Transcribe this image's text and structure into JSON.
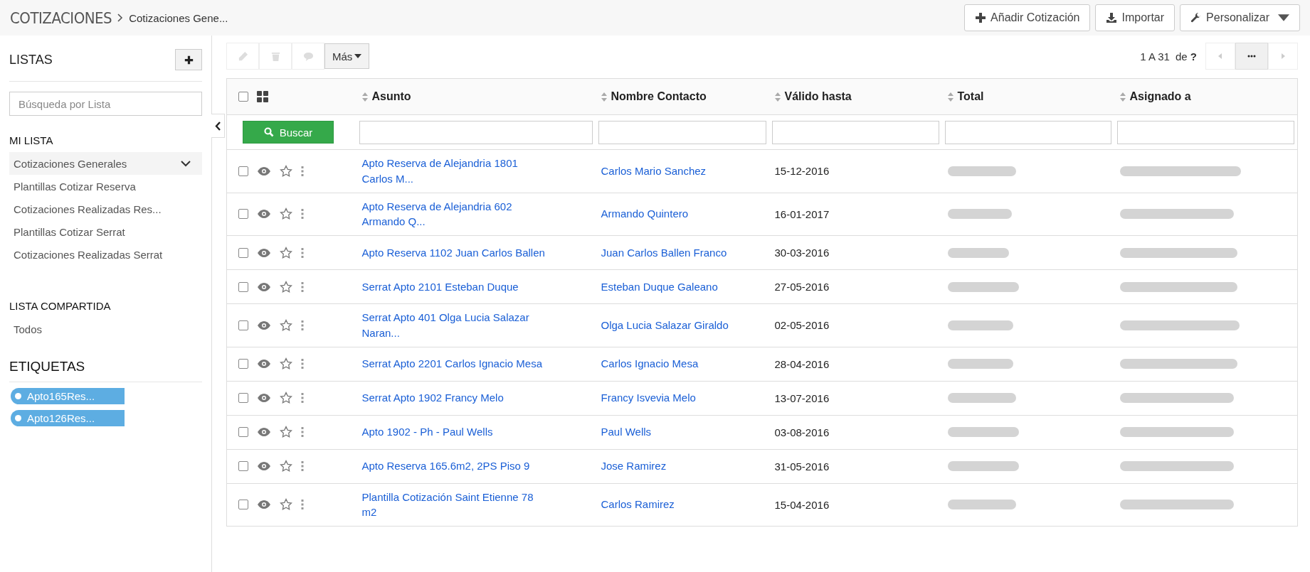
{
  "header": {
    "module": "COTIZACIONES",
    "breadcrumb": "Cotizaciones Gene...",
    "actions": [
      {
        "kind": "add",
        "label": "Añadir Cotización"
      },
      {
        "kind": "import",
        "label": "Importar"
      },
      {
        "kind": "customize",
        "label": "Personalizar"
      }
    ]
  },
  "sidebar": {
    "title": "LISTAS",
    "search": {
      "placeholder": "Búsqueda por Lista"
    },
    "my_lists": {
      "title": "MI LISTA",
      "items": [
        {
          "label": "Cotizaciones Generales",
          "selected": true
        },
        {
          "label": "Plantillas Cotizar Reserva",
          "selected": false
        },
        {
          "label": "Cotizaciones Realizadas Res...",
          "selected": false
        },
        {
          "label": "Plantillas Cotizar Serrat",
          "selected": false
        },
        {
          "label": "Cotizaciones Realizadas Serrat",
          "selected": false
        }
      ]
    },
    "shared_lists": {
      "title": "LISTA COMPARTIDA",
      "items": [
        {
          "label": "Todos",
          "selected": false
        }
      ]
    },
    "tags": {
      "title": "ETIQUETAS",
      "items": [
        {
          "label": "Apto165Res...",
          "color": "#5dade2"
        },
        {
          "label": "Apto126Res...",
          "color": "#5dade2"
        }
      ]
    }
  },
  "toolbar": {
    "more": "Más",
    "pagination": {
      "range": "1 A 31",
      "total": "de **?**"
    }
  },
  "table": {
    "select_all": {
      "checked": false
    },
    "search_button": "Buscar",
    "columns": [
      "Asunto",
      "Nombre Contacto",
      "Válido hasta",
      "Total",
      "Asignado a"
    ],
    "rows": [
      {
        "checked": false,
        "starred": false,
        "subject": "Apto Reserva de Alejandria 1801 Carlos M...",
        "contact": "Carlos Mario Sanchez",
        "valid_until": "15-12-2016"
      },
      {
        "checked": false,
        "starred": false,
        "subject": "Apto Reserva de Alejandria 602 Armando Q...",
        "contact": "Armando Quintero",
        "valid_until": "16-01-2017"
      },
      {
        "checked": false,
        "starred": false,
        "subject": "Apto Reserva 1102 Juan Carlos Ballen",
        "contact": "Juan Carlos Ballen Franco",
        "valid_until": "30-03-2016"
      },
      {
        "checked": false,
        "starred": false,
        "subject": "Serrat Apto 2101 Esteban Duque",
        "contact": "Esteban Duque Galeano",
        "valid_until": "27-05-2016"
      },
      {
        "checked": false,
        "starred": false,
        "subject": "Serrat Apto 401 Olga Lucia Salazar Naran...",
        "contact": "Olga Lucia Salazar Giraldo",
        "valid_until": "02-05-2016"
      },
      {
        "checked": false,
        "starred": false,
        "subject": "Serrat Apto 2201 Carlos Ignacio Mesa",
        "contact": "Carlos Ignacio Mesa",
        "valid_until": "28-04-2016"
      },
      {
        "checked": false,
        "starred": false,
        "subject": "Serrat Apto 1902 Francy Melo",
        "contact": "Francy Isvevia Melo",
        "valid_until": "13-07-2016"
      },
      {
        "checked": false,
        "starred": false,
        "subject": "Apto 1902 - Ph - Paul Wells",
        "contact": "Paul Wells",
        "valid_until": "03-08-2016"
      },
      {
        "checked": false,
        "starred": false,
        "subject": "Apto Reserva 165.6m2, 2PS Piso 9",
        "contact": "Jose Ramirez",
        "valid_until": "31-05-2016"
      },
      {
        "checked": false,
        "starred": false,
        "subject": "Plantilla Cotización Saint Etienne 78 m2",
        "contact": "Carlos Ramirez",
        "valid_until": "15-04-2016"
      }
    ]
  }
}
